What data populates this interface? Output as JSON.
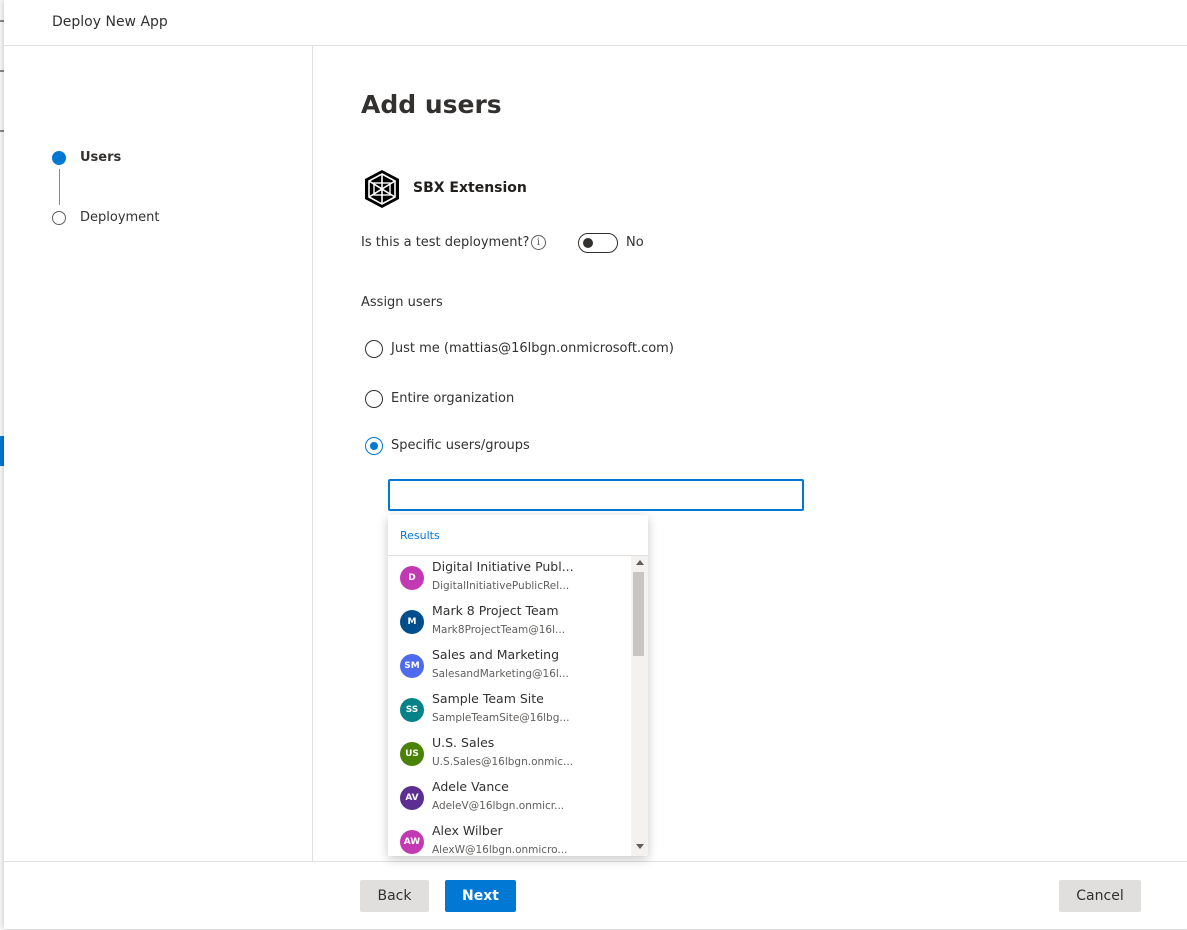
{
  "panel": {
    "title": "Deploy New App"
  },
  "steps": [
    {
      "label": "Users",
      "state": "active"
    },
    {
      "label": "Deployment",
      "state": "pending"
    }
  ],
  "main": {
    "heading": "Add users",
    "app_name": "SBX Extension",
    "test_deployment": {
      "label": "Is this a test deployment?",
      "toggle_text": "No",
      "on": false
    },
    "assign_label": "Assign users",
    "options": [
      {
        "label": "Just me (mattias@16lbgn.onmicrosoft.com)",
        "checked": false
      },
      {
        "label": "Entire organization",
        "checked": false
      },
      {
        "label": "Specific users/groups",
        "checked": true
      }
    ],
    "search": {
      "value": "",
      "placeholder": ""
    }
  },
  "dropdown": {
    "header": "Results",
    "results": [
      {
        "initials": "D",
        "name": "Digital Initiative Publ...",
        "mail": "DigitalInitiativePublicRel...",
        "color": "#c239b3"
      },
      {
        "initials": "M",
        "name": "Mark 8 Project Team",
        "mail": "Mark8ProjectTeam@16l...",
        "color": "#004e8c"
      },
      {
        "initials": "SM",
        "name": "Sales and Marketing",
        "mail": "SalesandMarketing@16l...",
        "color": "#4f6bed"
      },
      {
        "initials": "SS",
        "name": "Sample Team Site",
        "mail": "SampleTeamSite@16lbg...",
        "color": "#038387"
      },
      {
        "initials": "US",
        "name": "U.S. Sales",
        "mail": "U.S.Sales@16lbgn.onmic...",
        "color": "#498205"
      },
      {
        "initials": "AV",
        "name": "Adele Vance",
        "mail": "AdeleV@16lbgn.onmicr...",
        "color": "#5c2e91"
      },
      {
        "initials": "AW",
        "name": "Alex Wilber",
        "mail": "AlexW@16lbgn.onmicro...",
        "color": "#c239b3"
      }
    ]
  },
  "footer": {
    "back_label": "Back",
    "next_label": "Next",
    "cancel_label": "Cancel"
  },
  "colors": {
    "accent": "#0078d4"
  }
}
